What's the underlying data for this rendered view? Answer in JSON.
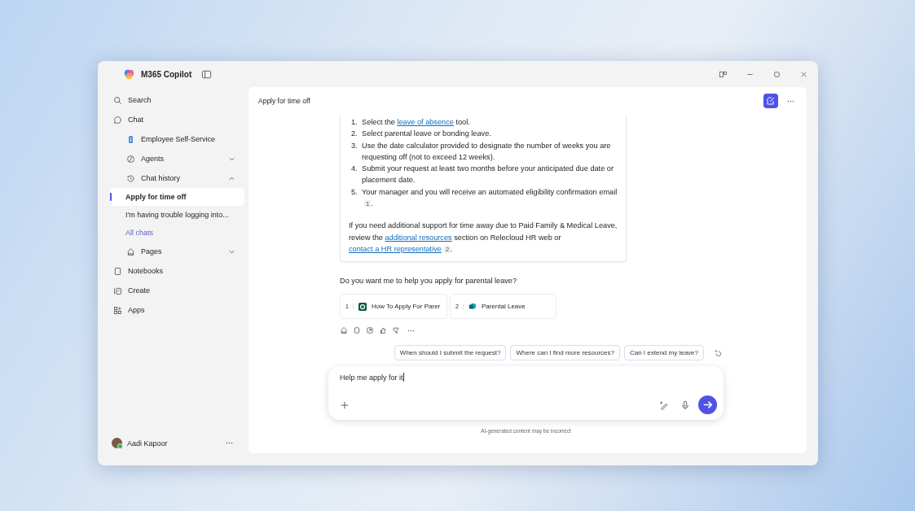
{
  "window": {
    "title": "M365 Copilot"
  },
  "sidebar": {
    "items": [
      {
        "kind": "search",
        "label": "Search"
      },
      {
        "kind": "chat",
        "label": "Chat",
        "children": [
          {
            "kind": "agent",
            "label": "Employee Self-Service"
          },
          {
            "kind": "agents",
            "label": "Agents",
            "expanded": false
          },
          {
            "kind": "history",
            "label": "Chat history",
            "expanded": true,
            "children": [
              {
                "label": "Apply for time off",
                "selected": true
              },
              {
                "label": "I'm having trouble logging into...",
                "selected": false
              }
            ],
            "more_link": "All chats"
          },
          {
            "kind": "pages",
            "label": "Pages",
            "expanded": false
          }
        ]
      },
      {
        "kind": "notebooks",
        "label": "Notebooks"
      },
      {
        "kind": "create",
        "label": "Create"
      },
      {
        "kind": "apps",
        "label": "Apps"
      }
    ],
    "user": {
      "name": "Aadi Kapoor",
      "online": true
    }
  },
  "header": {
    "title": "Apply for time off"
  },
  "answer": {
    "steps": [
      {
        "number": "1.",
        "parts": [
          {
            "kind": "text",
            "text": "Select the "
          },
          {
            "kind": "link",
            "text": "leave of absence"
          },
          {
            "kind": "text",
            "text": " tool."
          }
        ]
      },
      {
        "number": "2.",
        "parts": [
          {
            "kind": "text",
            "text": "Select parental leave or bonding leave."
          }
        ]
      },
      {
        "number": "3.",
        "parts": [
          {
            "kind": "text",
            "text": "Use the date calculator provided to designate the number of weeks you are requesting off (not to exceed 12 weeks)."
          }
        ]
      },
      {
        "number": "4.",
        "parts": [
          {
            "kind": "text",
            "text": "Submit your request at least two months before your anticipated due date or placement date."
          }
        ]
      },
      {
        "number": "5.",
        "parts": [
          {
            "kind": "text",
            "text": "Your manager and you will receive an automated eligibility confirmation email "
          },
          {
            "kind": "cite",
            "text": "1"
          },
          {
            "kind": "text",
            "text": "."
          }
        ]
      }
    ],
    "paragraph": [
      {
        "kind": "text",
        "text": "If you need additional support for time away due to Paid Family & Medical Leave, review the "
      },
      {
        "kind": "link",
        "text": "additional resources"
      },
      {
        "kind": "text",
        "text": " section on Relecloud HR web or "
      },
      {
        "kind": "link",
        "text": "contact a HR representative"
      },
      {
        "kind": "cite",
        "text": "2"
      },
      {
        "kind": "text",
        "text": "."
      }
    ]
  },
  "question": "Do you want me to help you apply for parental leave?",
  "references": [
    {
      "number": "1",
      "kind": "page",
      "title": "How To Apply For Parer"
    },
    {
      "number": "2",
      "kind": "site",
      "title": "Parental Leave"
    }
  ],
  "suggestions": [
    "When should I submit the request?",
    "Where can I find more resources?",
    "Can I extend my leave?"
  ],
  "composer": {
    "value": "Help me apply for it"
  },
  "footer": "AI-generated content may be incorrect"
}
